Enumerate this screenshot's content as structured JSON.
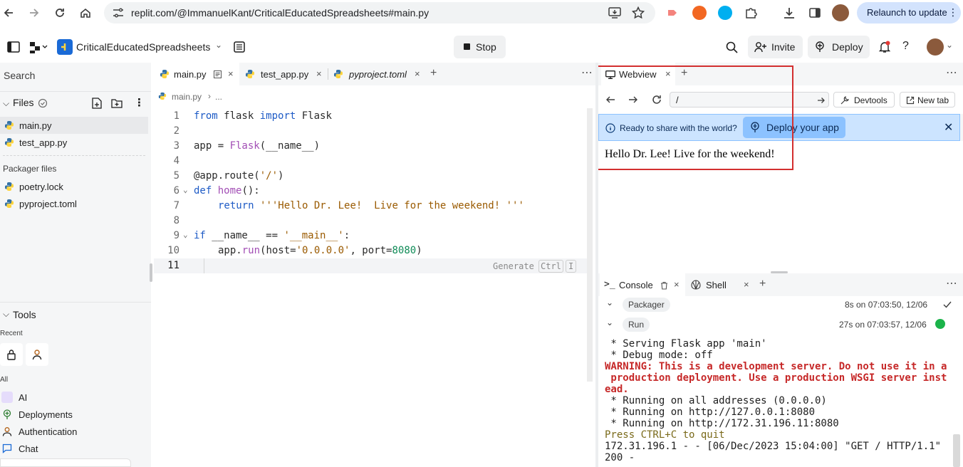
{
  "browser": {
    "url": "replit.com/@ImmanuelKant/CriticalEducatedSpreadsheets#main.py",
    "relaunch_label": "Relaunch to update"
  },
  "header": {
    "repl_name": "CriticalEducatedSpreadsheets",
    "stop_label": "Stop",
    "invite_label": "Invite",
    "deploy_label": "Deploy"
  },
  "sidebar": {
    "search_placeholder": "Search",
    "files_title": "Files",
    "files": [
      "main.py",
      "test_app.py"
    ],
    "packager_title": "Packager files",
    "packager_files": [
      "poetry.lock",
      "pyproject.toml"
    ],
    "tools_title": "Tools",
    "recent_label": "Recent",
    "all_label": "All",
    "tools": [
      "AI",
      "Deployments",
      "Authentication",
      "Chat"
    ]
  },
  "editor": {
    "tabs": [
      "main.py",
      "test_app.py",
      "pyproject.toml"
    ],
    "breadcrumb_file": "main.py",
    "breadcrumb_sep": "›",
    "breadcrumb_more": "...",
    "generate_label": "Generate",
    "generate_key1": "Ctrl",
    "generate_key2": "I",
    "line_numbers": [
      "1",
      "2",
      "3",
      "4",
      "5",
      "6",
      "7",
      "8",
      "9",
      "10",
      "11"
    ],
    "code": {
      "l1a": "from",
      "l1b": " flask ",
      "l1c": "import",
      "l1d": " Flask",
      "l3a": "app = ",
      "l3b": "Flask",
      "l3c": "(__name__)",
      "l5a": "@app.route(",
      "l5b": "'/'",
      "l5c": ")",
      "l6a": "def",
      "l6b": " home",
      "l6c": "():",
      "l7a": "return",
      "l7b": " ",
      "l7c": "'''Hello Dr. Lee!  Live for the weekend! '''",
      "l9a": "if",
      "l9b": " __name__ == ",
      "l9c": "'__main__'",
      "l9d": ":",
      "l10a": "app.",
      "l10b": "run",
      "l10c": "(host=",
      "l10d": "'0.0.0.0'",
      "l10e": ", port=",
      "l10f": "8080",
      "l10g": ")"
    }
  },
  "webview": {
    "tab_label": "Webview",
    "path": "/",
    "devtools_label": "Devtools",
    "newtab_label": "New tab",
    "banner_text": "Ready to share with the world?",
    "deploy_app_label": "Deploy your app",
    "content": "Hello Dr. Lee! Live for the weekend!"
  },
  "console": {
    "tab_console": "Console",
    "tab_shell": "Shell",
    "packager_label": "Packager",
    "packager_time": "8s on 07:03:50, 12/06",
    "run_label": "Run",
    "run_time": "27s on 07:03:57, 12/06",
    "lines": [
      {
        "text": " * Serving Flask app 'main'",
        "style": "normal"
      },
      {
        "text": " * Debug mode: off",
        "style": "normal"
      },
      {
        "text": "WARNING: This is a development server. Do not use it in a",
        "style": "red"
      },
      {
        "text": " production deployment. Use a production WSGI server inst",
        "style": "red"
      },
      {
        "text": "ead.",
        "style": "red"
      },
      {
        "text": " * Running on all addresses (0.0.0.0)",
        "style": "normal"
      },
      {
        "text": " * Running on http://127.0.0.1:8080",
        "style": "normal"
      },
      {
        "text": " * Running on http://172.31.196.11:8080",
        "style": "normal"
      },
      {
        "text": "Press CTRL+C to quit",
        "style": "olive"
      },
      {
        "text": "172.31.196.1 - - [06/Dec/2023 15:04:00] \"GET / HTTP/1.1\"",
        "style": "normal"
      },
      {
        "text": "200 -",
        "style": "normal"
      }
    ]
  },
  "colors": {
    "accent": "#0079f2",
    "highlight_box": "#d32f2f",
    "banner_bg": "#cce4ff",
    "run_ok": "#1bb34a"
  }
}
